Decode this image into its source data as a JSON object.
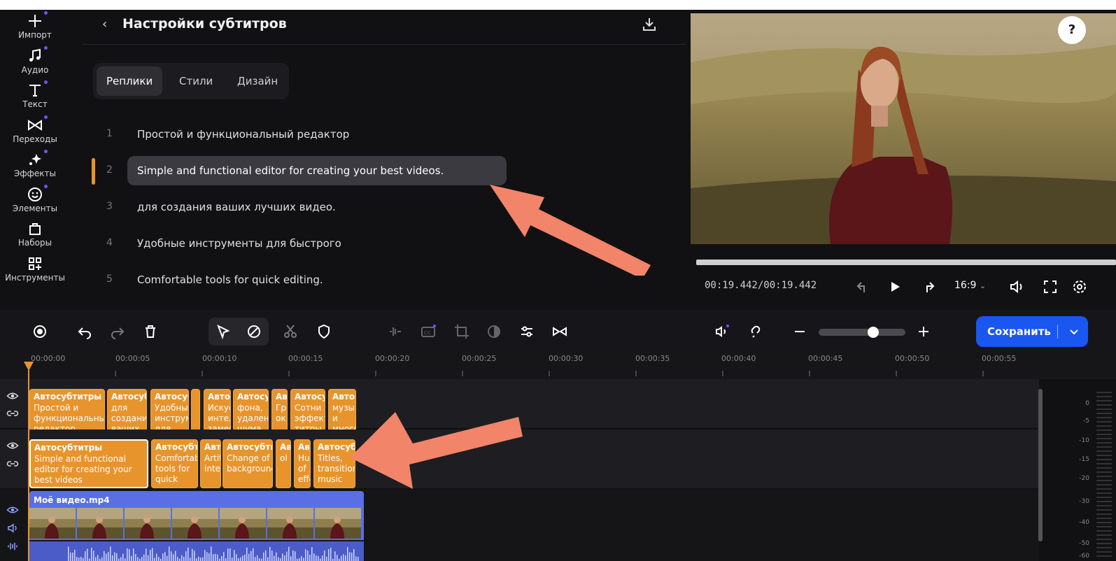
{
  "sidebar": {
    "items": [
      {
        "label": "Импорт",
        "icon": "plus-icon"
      },
      {
        "label": "Аудио",
        "icon": "music-note-icon"
      },
      {
        "label": "Текст",
        "icon": "text-icon"
      },
      {
        "label": "Переходы",
        "icon": "transition-icon"
      },
      {
        "label": "Эффекты",
        "icon": "sparkle-icon"
      },
      {
        "label": "Элементы",
        "icon": "smiley-icon"
      },
      {
        "label": "Наборы",
        "icon": "bag-icon"
      },
      {
        "label": "Инструменты",
        "icon": "grid-plus-icon"
      }
    ]
  },
  "panel": {
    "title": "Настройки субтитров",
    "tabs": [
      "Реплики",
      "Стили",
      "Дизайн"
    ],
    "active_tab": "Реплики",
    "lines": [
      {
        "num": "1",
        "text": "Простой и функциональный редактор"
      },
      {
        "num": "2",
        "text": "Simple and functional editor for creating your best videos."
      },
      {
        "num": "3",
        "text": "для создания ваших лучших видео."
      },
      {
        "num": "4",
        "text": "Удобные инструменты для быстрого"
      },
      {
        "num": "5",
        "text": "Comfortable tools for quick editing."
      }
    ],
    "selected_line": 2
  },
  "player": {
    "help": "?",
    "time": "00:19.442/00:19.442",
    "ratio": "16:9",
    "progress": 1.0
  },
  "toolbar": {
    "save_label": "Сохранить",
    "zoom_level": 0.6
  },
  "timeline": {
    "ticks": [
      "00:00:00",
      "00:00:05",
      "00:00:10",
      "00:00:15",
      "00:00:20",
      "00:00:25",
      "00:00:30",
      "00:00:35",
      "00:00:40",
      "00:00:45",
      "00:00:50",
      "00:00:55"
    ],
    "subtitle_track_1": [
      {
        "title": "Автосубтитры",
        "body": "Простой и функциональный редактор"
      },
      {
        "title": "Автосубтитры",
        "body": "для создания ваших"
      },
      {
        "title": "Автосубтитры",
        "body": "Удобные инструменты для"
      },
      {
        "title": "",
        "body": ""
      },
      {
        "title": "Автосубтитры",
        "body": "Искусственный интеллект заменит"
      },
      {
        "title": "Автосубтитры",
        "body": "фона, удаление шума"
      },
      {
        "title": "Автосубтитры",
        "body": "Грк ок"
      },
      {
        "title": "Автосубтитры",
        "body": "Сотни эффектов титры"
      },
      {
        "title": "Автосубтитры",
        "body": "музыки и много"
      }
    ],
    "subtitle_track_2": [
      {
        "title": "Автосубтитры",
        "body": "Simple and functional editor for creating your best videos"
      },
      {
        "title": "Автосубтитры",
        "body": "Comfortable tools for quick"
      },
      {
        "title": "Автосубтитры",
        "body": "Artificial intelligence"
      },
      {
        "title": "Автосубтитры",
        "body": "Change of background"
      },
      {
        "title": "Автосубтитры",
        "body": "ol"
      },
      {
        "title": "Автосубтитры",
        "body": "Hundreds of effects"
      },
      {
        "title": "Автосубтитры",
        "body": "Titles, transitions, music"
      }
    ],
    "video_clip": "Моё видео.mp4",
    "vu_labels": [
      "0",
      "-5",
      "-10",
      "-15",
      "-20",
      "-30",
      "-40",
      "-50",
      "-60"
    ]
  },
  "colors": {
    "accent_orange": "#e8942c",
    "save_blue": "#1a56f0",
    "video_clip": "#5a6ee6",
    "annotation_arrow": "#f2846a"
  }
}
